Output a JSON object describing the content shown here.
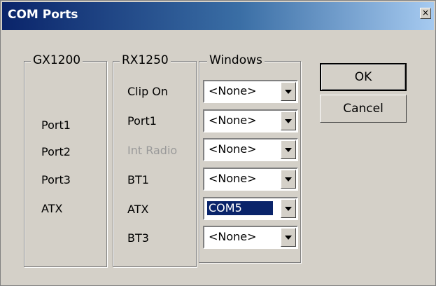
{
  "window": {
    "title": "COM Ports",
    "close_glyph": "×"
  },
  "groups": {
    "gx1200": "GX1200",
    "rx1250": "RX1250",
    "windows": "Windows"
  },
  "gx1200": {
    "port1": "Port1",
    "port2": "Port2",
    "port3": "Port3",
    "atx": "ATX"
  },
  "rx1250": {
    "clip_on": "Clip On",
    "port1": "Port1",
    "int_radio": "Int Radio",
    "bt1": "BT1",
    "atx": "ATX",
    "bt3": "BT3"
  },
  "windows": {
    "clip_on_value": "<None>",
    "port1_value": "<None>",
    "int_radio_value": "<None>",
    "bt1_value": "<None>",
    "atx_value": "COM5",
    "bt3_value": "<None>"
  },
  "buttons": {
    "ok": "OK",
    "cancel": "Cancel"
  },
  "icons": [
    "close-icon",
    "chevron-down-icon"
  ],
  "colors": {
    "title_start": "#0a246a",
    "title_end": "#a6caf0",
    "face": "#d4d0c8",
    "selection": "#0a246a"
  }
}
